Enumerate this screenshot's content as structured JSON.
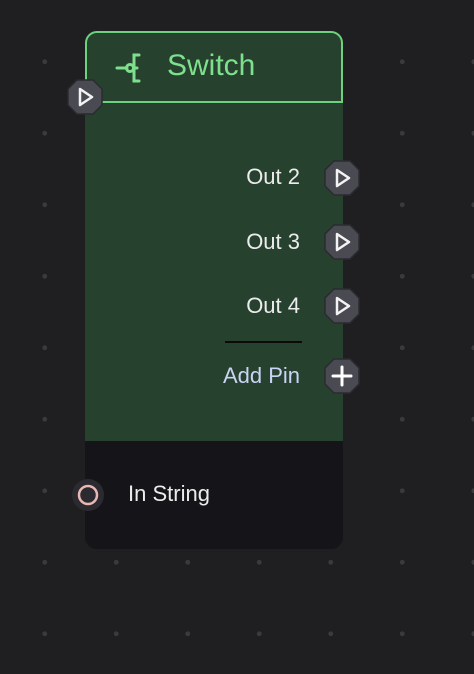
{
  "node": {
    "title": "Switch",
    "header_icon": "switch-branch-icon",
    "exec_in_icon": "exec-in-pin-icon",
    "outputs": [
      {
        "label": "Out 2",
        "icon": "exec-out-pin-icon"
      },
      {
        "label": "Out 3",
        "icon": "exec-out-pin-icon"
      },
      {
        "label": "Out 4",
        "icon": "exec-out-pin-icon"
      }
    ],
    "add_pin": {
      "label": "Add Pin",
      "icon": "plus-icon"
    },
    "inputs": [
      {
        "label": "In String",
        "icon": "string-pin-icon"
      }
    ]
  },
  "colors": {
    "canvas_bg": "#1f1f22",
    "grid_dot": "#3a3a3e",
    "node_body": "#27412f",
    "header_border": "#6dd27e",
    "title": "#7ee08d",
    "footer": "#151519",
    "pin_fill": "#4a4a52",
    "string_pin": "#e8b8b4"
  }
}
